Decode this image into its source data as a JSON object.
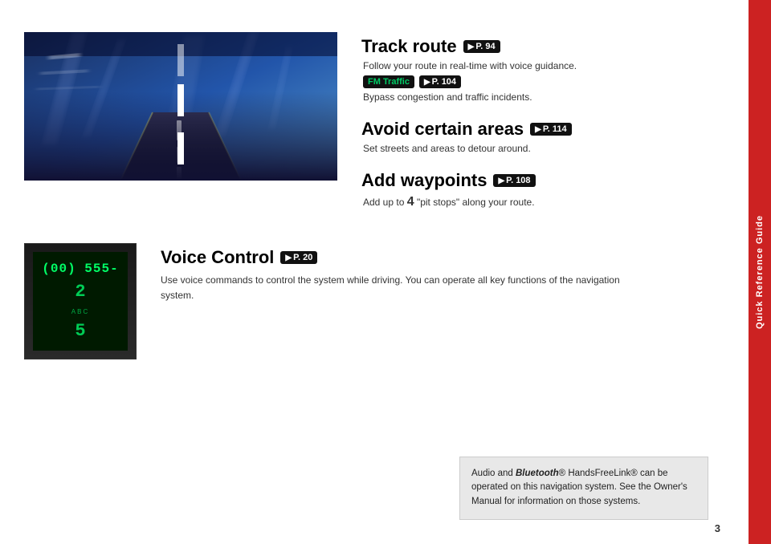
{
  "sidebar": {
    "label": "Quick Reference Guide",
    "bg_color": "#cc2222"
  },
  "top_image": {
    "alt": "Highway driving image"
  },
  "features": [
    {
      "id": "track-route",
      "title": "Track route",
      "page_badge": "P. 94",
      "description": "Follow your route in real-time with voice guidance.",
      "sub_feature": {
        "label": "FM Traffic",
        "page_badge": "P. 104",
        "description": "Bypass congestion and traffic incidents."
      }
    },
    {
      "id": "avoid-areas",
      "title": "Avoid certain areas",
      "page_badge": "P. 114",
      "description": "Set streets and areas to detour around.",
      "sub_feature": null
    },
    {
      "id": "add-waypoints",
      "title": "Add waypoints",
      "page_badge": "P. 108",
      "description": "Add up to 4 \"pit stops\" along your route.",
      "sub_feature": null
    }
  ],
  "voice_control": {
    "title": "Voice Control",
    "page_badge": "P. 20",
    "description": "Use voice commands to control the system while driving. You can operate all key functions of the navigation system.",
    "phone_display_number": "(00) 555-",
    "phone_key_2": "2",
    "phone_key_label": "ABC",
    "phone_key_5": "5"
  },
  "info_box": {
    "text_part1": "Audio and ",
    "bluetooth_italic": "Bluetooth",
    "text_part2": "® HandsFreeLink® can be operated on this navigation system. See the Owner's Manual for information on those systems."
  },
  "page_number": "3"
}
